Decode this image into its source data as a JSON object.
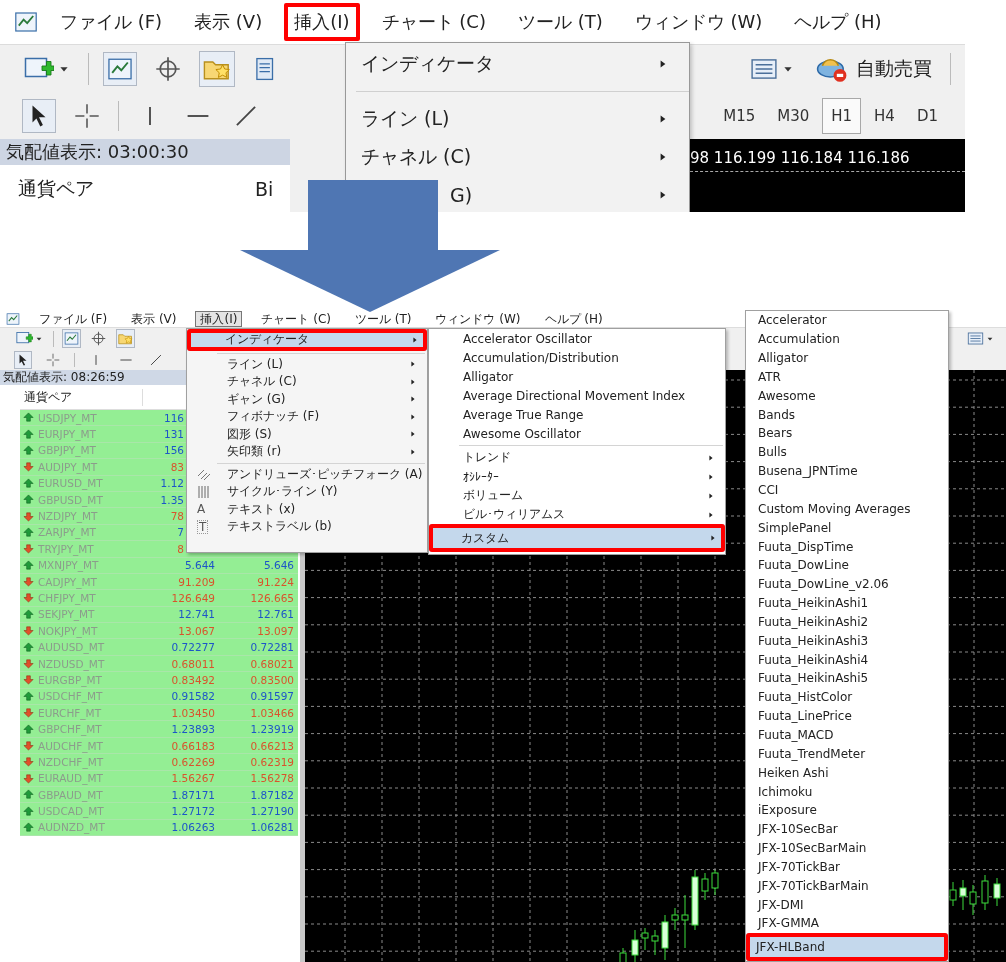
{
  "top_screenshot": {
    "menu_bar": [
      {
        "label": "ファイル (F)",
        "selected": false
      },
      {
        "label": "表示 (V)",
        "selected": false
      },
      {
        "label": "挿入(I)",
        "selected": true
      },
      {
        "label": "チャート (C)",
        "selected": false
      },
      {
        "label": "ツール (T)",
        "selected": false
      },
      {
        "label": "ウィンドウ (W)",
        "selected": false
      },
      {
        "label": "ヘルプ (H)",
        "selected": false
      }
    ],
    "auto_trading_button": "自動売買",
    "timeframes": [
      {
        "label": "M15",
        "selected": false
      },
      {
        "label": "M30",
        "selected": false
      },
      {
        "label": "H1",
        "selected": true
      },
      {
        "label": "H4",
        "selected": false
      },
      {
        "label": "D1",
        "selected": false
      }
    ],
    "market_watch": {
      "title": "気配値表示: 03:00:30",
      "columns": [
        "通貨ペア",
        "Bi"
      ]
    },
    "chart_prices": "98 116.199 116.184 116.186",
    "insert_menu": [
      {
        "label": "インディケータ",
        "kind": "submenu"
      },
      {
        "kind": "separator"
      },
      {
        "label": "ライン (L)",
        "kind": "submenu"
      },
      {
        "label": "チャネル (C)",
        "kind": "submenu"
      },
      {
        "label": "G)",
        "kind": "submenu"
      }
    ]
  },
  "bottom_screenshot": {
    "menu_bar": [
      {
        "label": "ファイル (F)",
        "selected": false
      },
      {
        "label": "表示 (V)",
        "selected": false
      },
      {
        "label": "挿入(I)",
        "selected": true
      },
      {
        "label": "チャート (C)",
        "selected": false
      },
      {
        "label": "ツール (T)",
        "selected": false
      },
      {
        "label": "ウィンドウ (W)",
        "selected": false
      },
      {
        "label": "ヘルプ (H)",
        "selected": false
      }
    ],
    "market_watch": {
      "title": "気配値表示: 08:26:59",
      "columns": [
        "通貨ペア"
      ],
      "rows": [
        {
          "symbol": "USDJPY_MT",
          "rising": true,
          "bid": "116"
        },
        {
          "symbol": "EURJPY_MT",
          "rising": true,
          "bid": "131"
        },
        {
          "symbol": "GBPJPY_MT",
          "rising": true,
          "bid": "156"
        },
        {
          "symbol": "AUDJPY_MT",
          "rising": false,
          "bid": "83"
        },
        {
          "symbol": "EURUSD_MT",
          "rising": true,
          "bid": "1.12"
        },
        {
          "symbol": "GBPUSD_MT",
          "rising": true,
          "bid": "1.35"
        },
        {
          "symbol": "NZDJPY_MT",
          "rising": false,
          "bid": "78"
        },
        {
          "symbol": "ZARJPY_MT",
          "rising": true,
          "bid": "7"
        },
        {
          "symbol": "TRYJPY_MT",
          "rising": false,
          "bid": "8"
        },
        {
          "symbol": "MXNJPY_MT",
          "rising": true,
          "bid": "5.644",
          "ask": "5.646"
        },
        {
          "symbol": "CADJPY_MT",
          "rising": false,
          "bid": "91.209",
          "ask": "91.224"
        },
        {
          "symbol": "CHFJPY_MT",
          "rising": false,
          "bid": "126.649",
          "ask": "126.665"
        },
        {
          "symbol": "SEKJPY_MT",
          "rising": true,
          "bid": "12.741",
          "ask": "12.761"
        },
        {
          "symbol": "NOKJPY_MT",
          "rising": false,
          "bid": "13.067",
          "ask": "13.097"
        },
        {
          "symbol": "AUDUSD_MT",
          "rising": true,
          "bid": "0.72277",
          "ask": "0.72281"
        },
        {
          "symbol": "NZDUSD_MT",
          "rising": false,
          "bid": "0.68011",
          "ask": "0.68021"
        },
        {
          "symbol": "EURGBP_MT",
          "rising": false,
          "bid": "0.83492",
          "ask": "0.83500"
        },
        {
          "symbol": "USDCHF_MT",
          "rising": true,
          "bid": "0.91582",
          "ask": "0.91597"
        },
        {
          "symbol": "EURCHF_MT",
          "rising": false,
          "bid": "1.03450",
          "ask": "1.03466"
        },
        {
          "symbol": "GBPCHF_MT",
          "rising": true,
          "bid": "1.23893",
          "ask": "1.23919"
        },
        {
          "symbol": "AUDCHF_MT",
          "rising": false,
          "bid": "0.66183",
          "ask": "0.66213"
        },
        {
          "symbol": "NZDCHF_MT",
          "rising": false,
          "bid": "0.62269",
          "ask": "0.62319"
        },
        {
          "symbol": "EURAUD_MT",
          "rising": false,
          "bid": "1.56267",
          "ask": "1.56278"
        },
        {
          "symbol": "GBPAUD_MT",
          "rising": true,
          "bid": "1.87171",
          "ask": "1.87182"
        },
        {
          "symbol": "USDCAD_MT",
          "rising": true,
          "bid": "1.27172",
          "ask": "1.27190"
        },
        {
          "symbol": "AUDNZD_MT",
          "rising": true,
          "bid": "1.06263",
          "ask": "1.06281"
        }
      ]
    },
    "insert_menu": [
      {
        "label": "インディケータ",
        "kind": "submenu",
        "selected": true
      },
      {
        "kind": "separator"
      },
      {
        "label": "ライン (L)",
        "kind": "submenu",
        "selected": false
      },
      {
        "label": "チャネル (C)",
        "kind": "submenu",
        "selected": false
      },
      {
        "label": "ギャン (G)",
        "kind": "submenu",
        "selected": false
      },
      {
        "label": "フィボナッチ (F)",
        "kind": "submenu",
        "selected": false
      },
      {
        "label": "図形 (S)",
        "kind": "submenu",
        "selected": false
      },
      {
        "label": "矢印類 (r)",
        "kind": "submenu",
        "selected": false
      },
      {
        "kind": "separator"
      },
      {
        "label": "アンドリューズ･ピッチフォーク (A)",
        "kind": "pitchfork",
        "selected": false
      },
      {
        "label": "サイクル･ライン (Y)",
        "kind": "cyclelines",
        "selected": false
      },
      {
        "label": "テキスト (x)",
        "kind": "text",
        "glyph": "A",
        "selected": false
      },
      {
        "label": "テキストラベル (b)",
        "kind": "textlabel",
        "glyph": "T",
        "selected": false
      }
    ],
    "indicators_menu": [
      {
        "label": "Accelerator Oscillator",
        "kind": "item",
        "selected": false
      },
      {
        "label": "Accumulation/Distribution",
        "kind": "item",
        "selected": false
      },
      {
        "label": "Alligator",
        "kind": "item",
        "selected": false
      },
      {
        "label": "Average Directional Movement Index",
        "kind": "item",
        "selected": false
      },
      {
        "label": "Average True Range",
        "kind": "item",
        "selected": false
      },
      {
        "label": "Awesome Oscillator",
        "kind": "item",
        "selected": false
      },
      {
        "kind": "separator"
      },
      {
        "label": "トレンド",
        "kind": "submenu",
        "selected": false
      },
      {
        "label": "ｵｼﾚｰﾀｰ",
        "kind": "submenu",
        "selected": false
      },
      {
        "label": "ボリューム",
        "kind": "submenu",
        "selected": false
      },
      {
        "label": "ビル･ウィリアムス",
        "kind": "submenu",
        "selected": false
      },
      {
        "label": "カスタム",
        "kind": "submenu",
        "selected": true
      }
    ],
    "custom_menu": [
      {
        "label": "Accelerator",
        "selected": false
      },
      {
        "label": "Accumulation",
        "selected": false
      },
      {
        "label": "Alligator",
        "selected": false
      },
      {
        "label": "ATR",
        "selected": false
      },
      {
        "label": "Awesome",
        "selected": false
      },
      {
        "label": "Bands",
        "selected": false
      },
      {
        "label": "Bears",
        "selected": false
      },
      {
        "label": "Bulls",
        "selected": false
      },
      {
        "label": "Busena_JPNTime",
        "selected": false
      },
      {
        "label": "CCI",
        "selected": false
      },
      {
        "label": "Custom Moving Averages",
        "selected": false
      },
      {
        "label": "SimplePanel",
        "selected": false
      },
      {
        "label": "Fuuta_DispTime",
        "selected": false
      },
      {
        "label": "Fuuta_DowLine",
        "selected": false
      },
      {
        "label": "Fuuta_DowLine_v2.06",
        "selected": false
      },
      {
        "label": "Fuuta_HeikinAshi1",
        "selected": false
      },
      {
        "label": "Fuuta_HeikinAshi2",
        "selected": false
      },
      {
        "label": "Fuuta_HeikinAshi3",
        "selected": false
      },
      {
        "label": "Fuuta_HeikinAshi4",
        "selected": false
      },
      {
        "label": "Fuuta_HeikinAshi5",
        "selected": false
      },
      {
        "label": "Fuuta_HistColor",
        "selected": false
      },
      {
        "label": "Fuuta_LinePrice",
        "selected": false
      },
      {
        "label": "Fuuta_MACD",
        "selected": false
      },
      {
        "label": "Fuuta_TrendMeter",
        "selected": false
      },
      {
        "label": "Heiken Ashi",
        "selected": false
      },
      {
        "label": "Ichimoku",
        "selected": false
      },
      {
        "label": "iExposure",
        "selected": false
      },
      {
        "label": "JFX-10SecBar",
        "selected": false
      },
      {
        "label": "JFX-10SecBarMain",
        "selected": false
      },
      {
        "label": "JFX-70TickBar",
        "selected": false
      },
      {
        "label": "JFX-70TickBarMain",
        "selected": false
      },
      {
        "label": "JFX-DMI",
        "selected": false
      },
      {
        "label": "JFX-GMMA",
        "selected": false
      },
      {
        "label": "JFX-HLBand",
        "selected": true
      }
    ]
  }
}
